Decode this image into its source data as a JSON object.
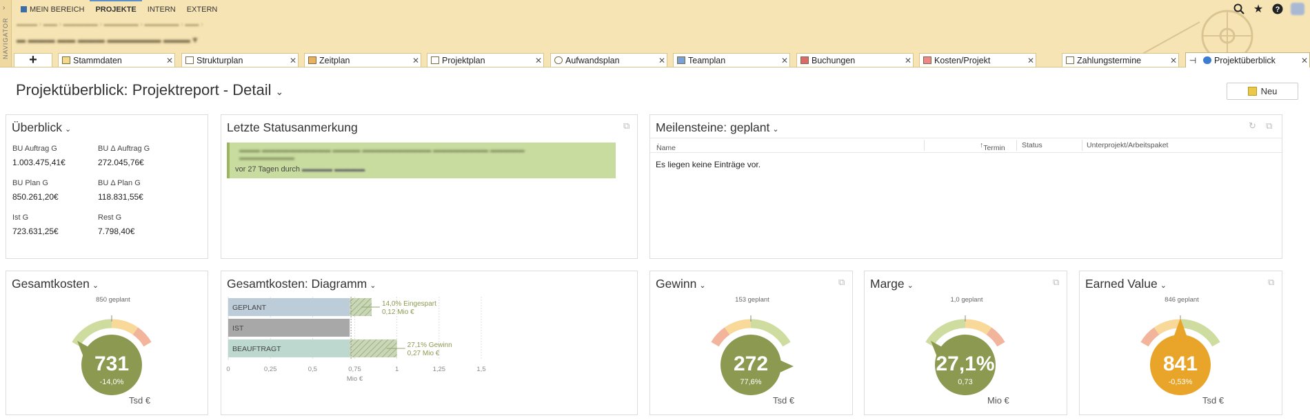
{
  "navigator": {
    "label": "NAVIGATOR"
  },
  "topnav": [
    {
      "label": "MEIN BEREICH",
      "active": false
    },
    {
      "label": "PROJEKTE",
      "active": true
    },
    {
      "label": "INTERN",
      "active": false
    },
    {
      "label": "EXTERN",
      "active": false
    }
  ],
  "tabs": [
    {
      "label": "Stammdaten"
    },
    {
      "label": "Strukturplan"
    },
    {
      "label": "Zeitplan"
    },
    {
      "label": "Projektplan"
    },
    {
      "label": "Aufwandsplan"
    },
    {
      "label": "Teamplan"
    },
    {
      "label": "Buchungen"
    },
    {
      "label": "Kosten/Projekt"
    },
    {
      "label": "Zahlungstermine"
    },
    {
      "label": "Projektüberblick"
    }
  ],
  "page": {
    "title": "Projektüberblick: Projektreport - Detail",
    "new_button": "Neu"
  },
  "overview": {
    "title": "Überblick",
    "items": [
      {
        "label": "BU Auftrag G",
        "value": "1.003.475,41€"
      },
      {
        "label": "BU Δ Auftrag G",
        "value": "272.045,76€"
      },
      {
        "label": "BU Plan G",
        "value": "850.261,20€"
      },
      {
        "label": "BU Δ Plan G",
        "value": "118.831,55€"
      },
      {
        "label": "Ist G",
        "value": "723.631,25€"
      },
      {
        "label": "Rest G",
        "value": "7.798,40€"
      }
    ]
  },
  "status": {
    "title": "Letzte Statusanmerkung",
    "footer_prefix": "vor 27 Tagen durch"
  },
  "milestones": {
    "title": "Meilensteine: geplant",
    "columns": [
      "Name",
      "Termin",
      "Status",
      "Unterprojekt/Arbeitspaket"
    ],
    "empty": "Es liegen keine Einträge vor."
  },
  "gauges": [
    {
      "title": "Gesamtkosten",
      "value": "731",
      "sub": "-14,0%",
      "plan": "850 geplant",
      "unit": "Tsd €",
      "color": "#8b9a50",
      "pointer": "left"
    },
    {
      "title": "Gewinn",
      "value": "272",
      "sub": "77,6%",
      "plan": "153 geplant",
      "unit": "Tsd €",
      "color": "#8b9a50",
      "pointer": "right"
    },
    {
      "title": "Marge",
      "value": "27,1%",
      "sub": "0,73",
      "plan": "1,0 geplant",
      "unit": "Mio €",
      "color": "#8b9a50",
      "pointer": "left"
    },
    {
      "title": "Earned Value",
      "value": "841",
      "sub": "-0,53%",
      "plan": "846 geplant",
      "unit": "Tsd €",
      "color": "#e8a52a",
      "pointer": "top"
    }
  ],
  "chart_data": {
    "type": "bar",
    "title": "Gesamtkosten: Diagramm",
    "categories": [
      "GEPLANT",
      "IST",
      "BEAUFTRAGT"
    ],
    "values": [
      0.85,
      0.72,
      1.0
    ],
    "savings": [
      {
        "category": "GEPLANT",
        "from": 0.72,
        "to": 0.85,
        "label1": "14,0% Eingespart",
        "label2": "0,12 Mio €"
      },
      {
        "category": "BEAUFTRAGT",
        "from": 0.72,
        "to": 1.0,
        "label1": "27,1% Gewinn",
        "label2": "0,27 Mio €"
      }
    ],
    "xticks": [
      "0",
      "0,25",
      "0,5",
      "0,75",
      "1",
      "1,25",
      "1,5"
    ],
    "xlim": [
      0,
      1.5
    ],
    "xlabel": "Mio €",
    "colors": {
      "GEPLANT": "#bcccd8",
      "IST": "#a8a8a8",
      "BEAUFTRAGT": "#bcd8cf"
    }
  }
}
